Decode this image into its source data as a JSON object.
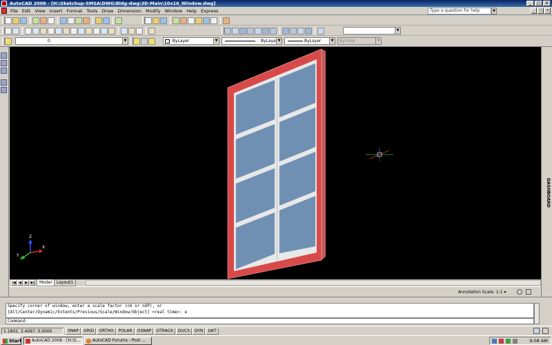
{
  "app": {
    "title": "AutoCAD 2008 - [H:\\Sketchup-SMSA\\DWG\\Bldg-dwg\\3D-Main\\10x16_Window.dwg]"
  },
  "menu": {
    "items": [
      "File",
      "Edit",
      "View",
      "Insert",
      "Format",
      "Tools",
      "Draw",
      "Dimension",
      "Modify",
      "Window",
      "Help",
      "Express"
    ],
    "help_placeholder": "Type a question for help"
  },
  "layers": {
    "current_layer": "0"
  },
  "properties": {
    "color": "ByLayer",
    "linetype": "ByLayer",
    "lineweight": "ByLayer",
    "plotstyle": "ByColor"
  },
  "layout_tabs": [
    "Model",
    "Layout1"
  ],
  "annotation": {
    "label": "Annotation Scale:",
    "value": "1:1"
  },
  "dashboard": {
    "label": "DASHBOARD"
  },
  "ucs_icon": {
    "x": "X",
    "y": "Y",
    "z": "Z"
  },
  "command": {
    "history": [
      "Specify corner of window, enter a scale factor (nX or nXP), or",
      "[All/Center/Dynamic/Extents/Previous/Scale/Window/Object] <real time>: e"
    ],
    "prompt": "Command:"
  },
  "status": {
    "coordinates": "1.1802, 3.4097, 0.0000",
    "modes": [
      "SNAP",
      "GRID",
      "ORTHO",
      "POLAR",
      "OSNAP",
      "OTRACK",
      "DUCS",
      "DYN",
      "LWT"
    ]
  },
  "taskbar": {
    "start": "Start",
    "items": [
      "AutoCAD 2008 - [H:\\S...",
      "AutoCAD Forums - Post ..."
    ],
    "clock": "9:08 AM"
  },
  "colors": {
    "canvas": "#000000",
    "frame": "#d84a4a",
    "glass": "#6f8fb3",
    "muntin": "#e8e8e8"
  }
}
